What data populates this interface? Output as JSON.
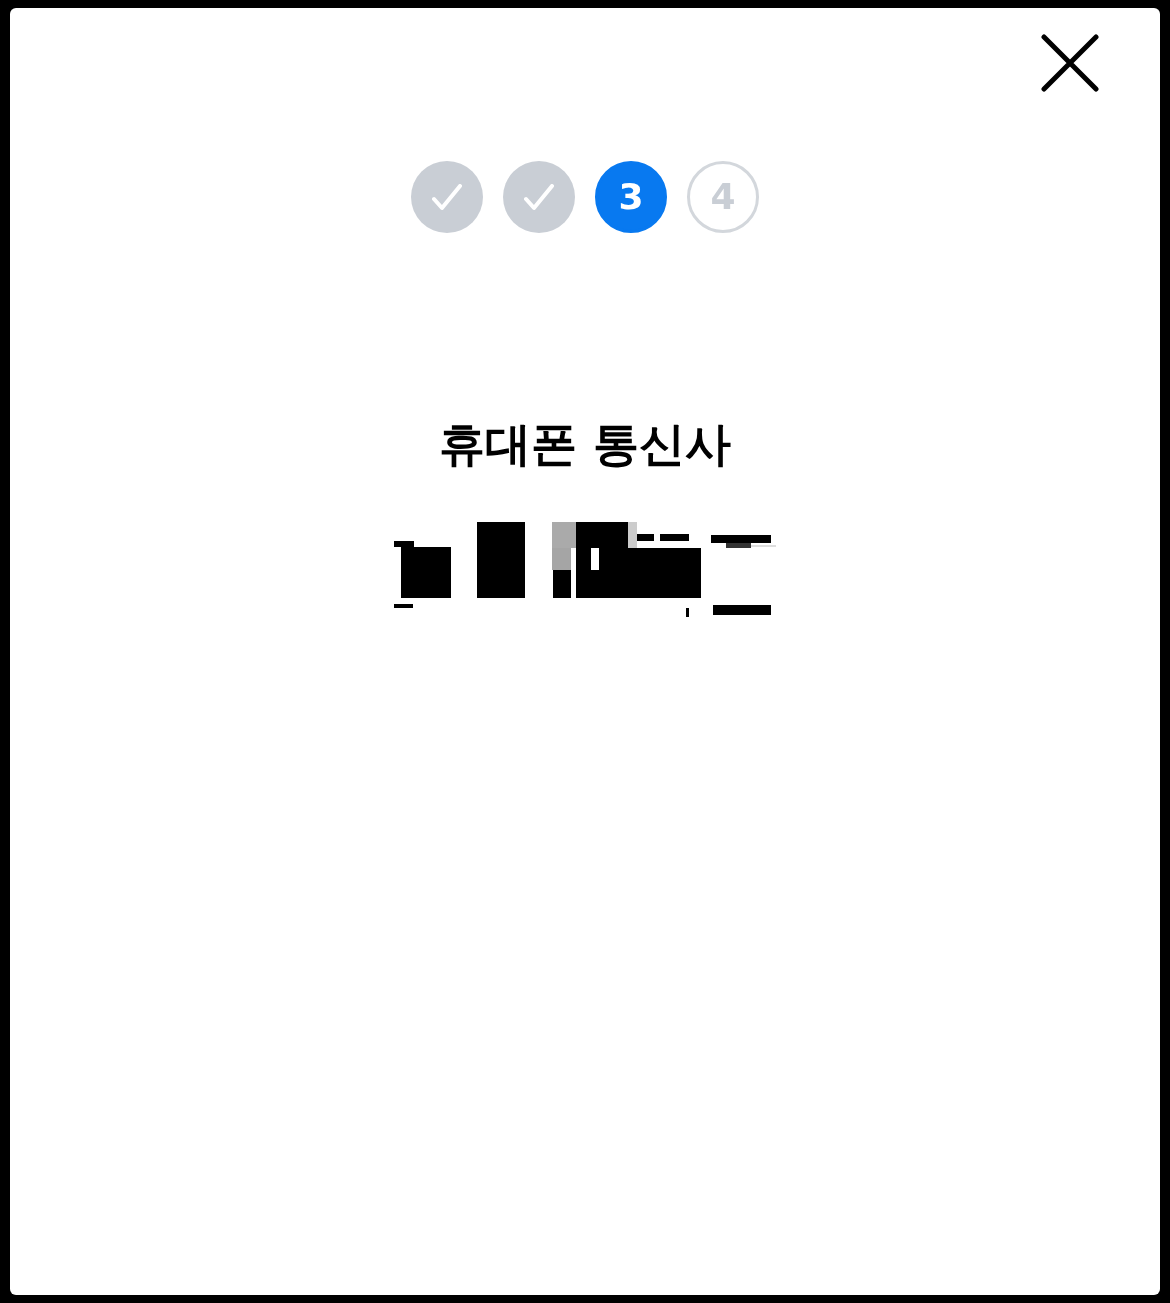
{
  "steps": [
    {
      "kind": "done",
      "selected": false
    },
    {
      "kind": "done",
      "selected": false
    },
    {
      "kind": "number",
      "label": "3",
      "selected": true
    },
    {
      "kind": "number",
      "label": "4",
      "selected": false
    }
  ],
  "title": "휴대폰 통신사"
}
